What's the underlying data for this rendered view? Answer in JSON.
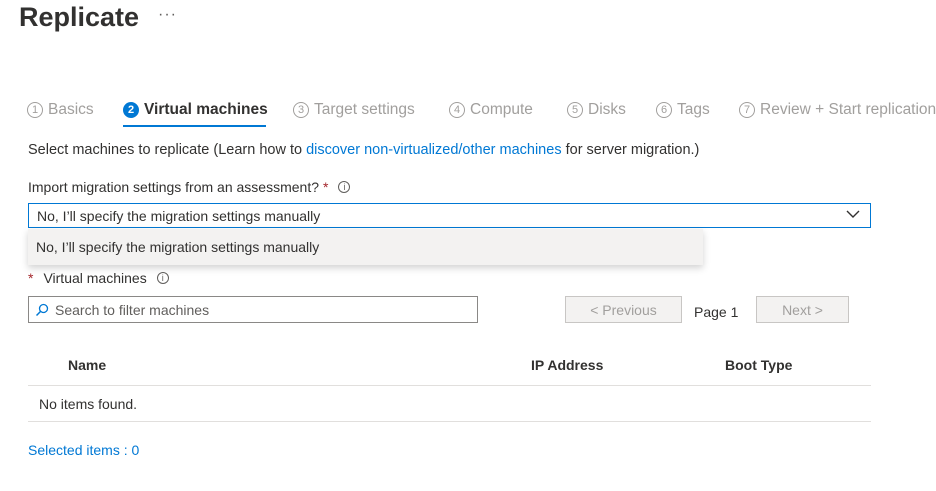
{
  "header": {
    "title": "Replicate",
    "more_label": "···"
  },
  "steps": [
    {
      "num": "1",
      "label": "Basics"
    },
    {
      "num": "2",
      "label": "Virtual machines",
      "active": true
    },
    {
      "num": "3",
      "label": "Target settings"
    },
    {
      "num": "4",
      "label": "Compute"
    },
    {
      "num": "5",
      "label": "Disks"
    },
    {
      "num": "6",
      "label": "Tags"
    },
    {
      "num": "7",
      "label": "Review + Start replication"
    }
  ],
  "description": {
    "prefix": "Select machines to replicate (Learn how to ",
    "link": "discover non-virtualized/other machines",
    "suffix": " for server migration.)"
  },
  "import_settings": {
    "label": "Import migration settings from an assessment?",
    "required_mark": "*",
    "info_icon": "info-icon",
    "selected": "No, I’ll specify the migration settings manually",
    "options": [
      "No, I’ll specify the migration settings manually"
    ]
  },
  "virtual_machines": {
    "required_mark": "*",
    "label": "Virtual machines",
    "search_placeholder": "Search to filter machines",
    "prev_label": "< Previous",
    "page_label": "Page 1",
    "next_label": "Next >",
    "columns": [
      "Name",
      "IP Address",
      "Boot Type"
    ],
    "empty_text": "No items found.",
    "selected_items": "Selected items : 0"
  },
  "colors": {
    "accent": "#0078d4",
    "required": "#a4262c",
    "disabled_text": "#a19f9d"
  }
}
